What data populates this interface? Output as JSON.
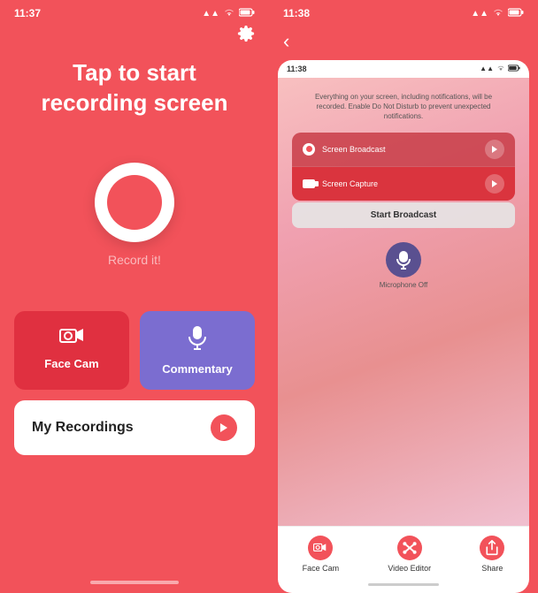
{
  "left": {
    "statusBar": {
      "time": "11:37",
      "signal": "●● ▲",
      "wifi": "WiFi",
      "battery": "■"
    },
    "gearIcon": "⚙",
    "title": "Tap to start\nrecording screen",
    "recordLabel": "Record it!",
    "faceCamLabel": "Face Cam",
    "commentaryLabel": "Commentary",
    "myRecordingsLabel": "My Recordings"
  },
  "right": {
    "statusBar": {
      "time": "11:38",
      "signal": "●●",
      "wifi": "WiFi",
      "battery": "■"
    },
    "backArrow": "‹",
    "inner": {
      "time": "11:38",
      "broadcastText": "Everything on your screen, including notifications, will be recorded. Enable Do Not Disturb to prevent unexpected notifications.",
      "screenBroadcastLabel": "Screen Broadcast",
      "screenCaptureLabel": "Screen Capture",
      "startBroadcastLabel": "Start Broadcast",
      "microphoneLabel": "Microphone\nOff"
    },
    "tabs": {
      "faceCam": "Face Cam",
      "videoEditor": "Video Editor",
      "share": "Share"
    }
  }
}
